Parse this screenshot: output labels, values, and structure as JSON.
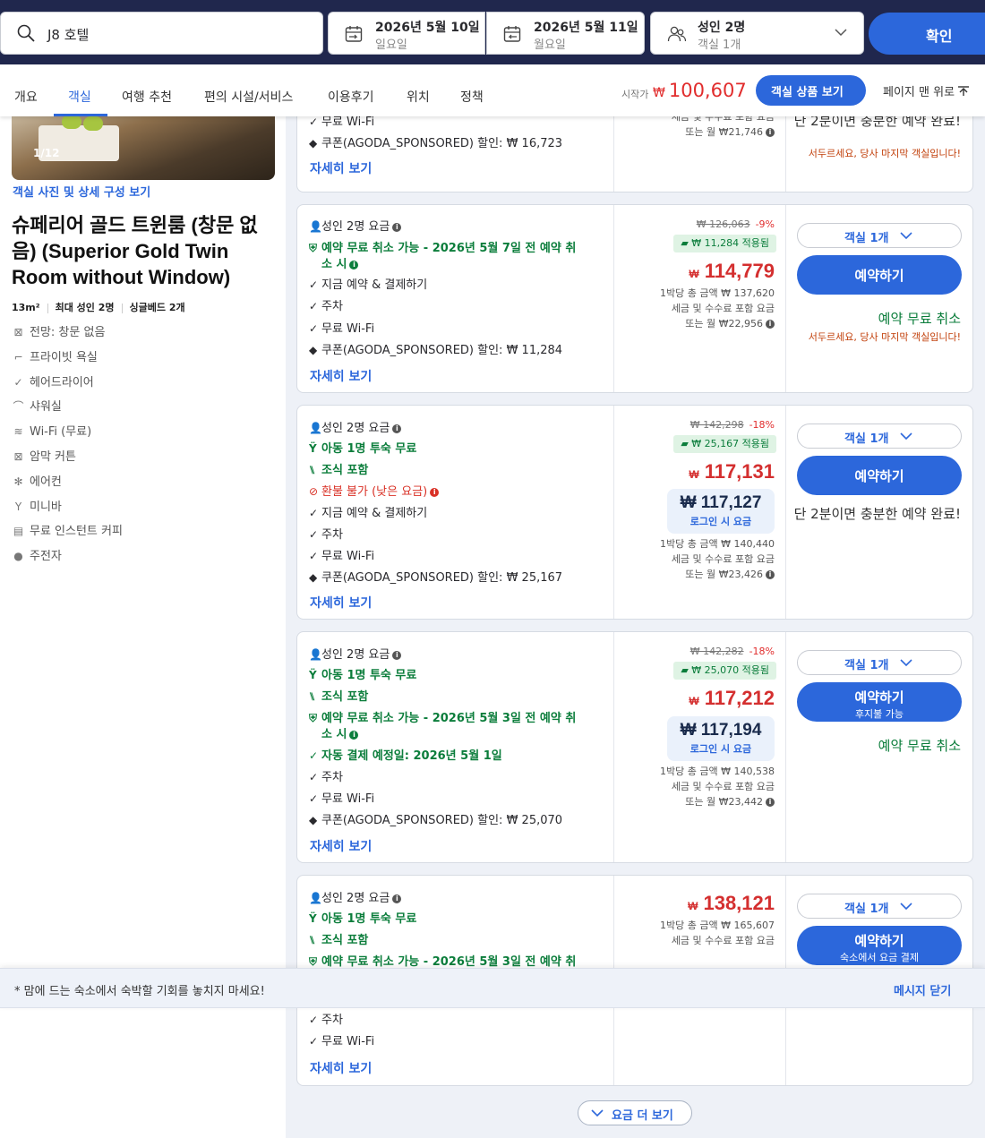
{
  "search": {
    "hotel_name": "J8 호텔",
    "checkin_date": "2026년 5월 10일",
    "checkin_day": "일요일",
    "checkout_date": "2026년 5월 11일",
    "checkout_day": "월요일",
    "guests": "성인 2명",
    "rooms": "객실 1개",
    "confirm_label": "확인"
  },
  "tabs": [
    "개요",
    "객실",
    "여행 추천",
    "편의 시설/서비스",
    "이용후기",
    "위치",
    "정책"
  ],
  "active_tab": "객실",
  "header": {
    "from_label": "시작가",
    "from_currency": "₩",
    "from_price": "100,607",
    "view_rooms_label": "객실 상품 보기",
    "to_top_label": "페이지 맨 위로"
  },
  "room": {
    "photo_counter": "1/12",
    "photo_link": "객실 사진 및 상세 구성 보기",
    "title": "슈페리어 골드 트윈룸 (창문 없음) (Superior Gold Twin Room without Window)",
    "size": "13m²",
    "max_guests": "최대 성인 2명",
    "beds": "싱글베드 2개",
    "amenities": [
      {
        "icon": "view-icon",
        "label": "전망: 창문 없음"
      },
      {
        "icon": "bathroom-icon",
        "label": "프라이빗 욕실"
      },
      {
        "icon": "check-icon",
        "label": "헤어드라이어"
      },
      {
        "icon": "shower-icon",
        "label": "샤워실"
      },
      {
        "icon": "wifi-icon",
        "label": "Wi-Fi (무료)"
      },
      {
        "icon": "curtain-icon",
        "label": "암막 커튼"
      },
      {
        "icon": "ac-icon",
        "label": "에어컨"
      },
      {
        "icon": "minibar-icon",
        "label": "미니바"
      },
      {
        "icon": "coffee-icon",
        "label": "무료 인스턴트 커피"
      },
      {
        "icon": "parking-icon",
        "label": "주전자"
      }
    ]
  },
  "offers": [
    {
      "features": [
        "무료 Wi-Fi",
        "쿠폰(AGODA_SPONSORED) 할인: ₩ 16,723"
      ],
      "details_label": "자세히 보기",
      "price_info": [
        "세금 및 수수료 포함 요금",
        "또는 월 ₩21,746"
      ],
      "enough": "단 2분이면 충분한 예약 완료!",
      "urgent": "서두르세요, 당사 마지막 객실입니다!"
    },
    {
      "features": [
        "성인 2명 요금",
        "예약 무료 취소 가능 - 2026년 5월 7일 전 예약 취",
        "소 시",
        "지금 예약 & 결제하기",
        "주차",
        "무료 Wi-Fi",
        "쿠폰(AGODA_SPONSORED) 할인: ₩ 11,284"
      ],
      "details_label": "자세히 보기",
      "original_price": "₩ 126,063",
      "discount": "-9%",
      "coupon": "₩ 11,284 적용됨",
      "currency": "₩",
      "price": "114,779",
      "price_info": [
        "1박당 총 금액 ₩ 137,620",
        "세금 및 수수료 포함 요금",
        "또는 월 ₩22,956"
      ],
      "rooms_label": "객실 1개",
      "book_label": "예약하기",
      "free_cancel": "예약 무료 취소",
      "urgent": "서두르세요, 당사 마지막 객실입니다!"
    },
    {
      "features": [
        "성인 2명 요금",
        "아동 1명 투숙 무료",
        "조식 포함",
        "환불 불가 (낮은 요금)",
        "지금 예약 & 결제하기",
        "주차",
        "무료 Wi-Fi",
        "쿠폰(AGODA_SPONSORED) 할인: ₩ 25,167"
      ],
      "details_label": "자세히 보기",
      "original_price": "₩ 142,298",
      "discount": "-18%",
      "coupon": "₩ 25,167 적용됨",
      "currency": "₩",
      "price": "117,131",
      "login_price": "₩ 117,127",
      "login_label": "로그인 시 요금",
      "price_info": [
        "1박당 총 금액 ₩ 140,440",
        "세금 및 수수료 포함 요금",
        "또는 월 ₩23,426"
      ],
      "rooms_label": "객실 1개",
      "book_label": "예약하기",
      "enough": "단 2분이면 충분한 예약 완료!"
    },
    {
      "features": [
        "성인 2명 요금",
        "아동 1명 투숙 무료",
        "조식 포함",
        "예약 무료 취소 가능 - 2026년 5월 3일 전 예약 취",
        "소 시",
        "자동 결제 예정일: 2026년 5월 1일",
        "주차",
        "무료 Wi-Fi",
        "쿠폰(AGODA_SPONSORED) 할인: ₩ 25,070"
      ],
      "details_label": "자세히 보기",
      "original_price": "₩ 142,282",
      "discount": "-18%",
      "coupon": "₩ 25,070 적용됨",
      "currency": "₩",
      "price": "117,212",
      "login_price": "₩ 117,194",
      "login_label": "로그인 시 요금",
      "price_info": [
        "1박당 총 금액 ₩ 140,538",
        "세금 및 수수료 포함 요금",
        "또는 월 ₩23,442"
      ],
      "rooms_label": "객실 1개",
      "book_label": "예약하기",
      "book_sub": "후지불 가능",
      "free_cancel": "예약 무료 취소"
    },
    {
      "features": [
        "성인 2명 요금",
        "아동 1명 투숙 무료",
        "조식 포함",
        "예약 무료 취소 가능 - 2026년 5월 3일 전 예약 취",
        "주차",
        "무료 Wi-Fi"
      ],
      "details_label": "자세히 보기",
      "currency": "₩",
      "price": "138,121",
      "price_info": [
        "1박당 총 금액 ₩ 165,607",
        "세금 및 수수료 포함 요금"
      ],
      "rooms_label": "객실 1개",
      "book_label": "예약하기",
      "book_sub": "숙소에서 요금 결제"
    }
  ],
  "more_rates_label": "요금 더 보기",
  "banner": {
    "message": "* 맘에 드는 숙소에서 숙박할 기회를 놓치지 마세요!",
    "close_label": "메시지 닫기"
  },
  "colors": {
    "navy": "#20274d",
    "accent_blue": "#2c67db",
    "price_red": "#d42f2f",
    "green": "#0b7d3b",
    "urgent_orange": "#c2410c"
  }
}
